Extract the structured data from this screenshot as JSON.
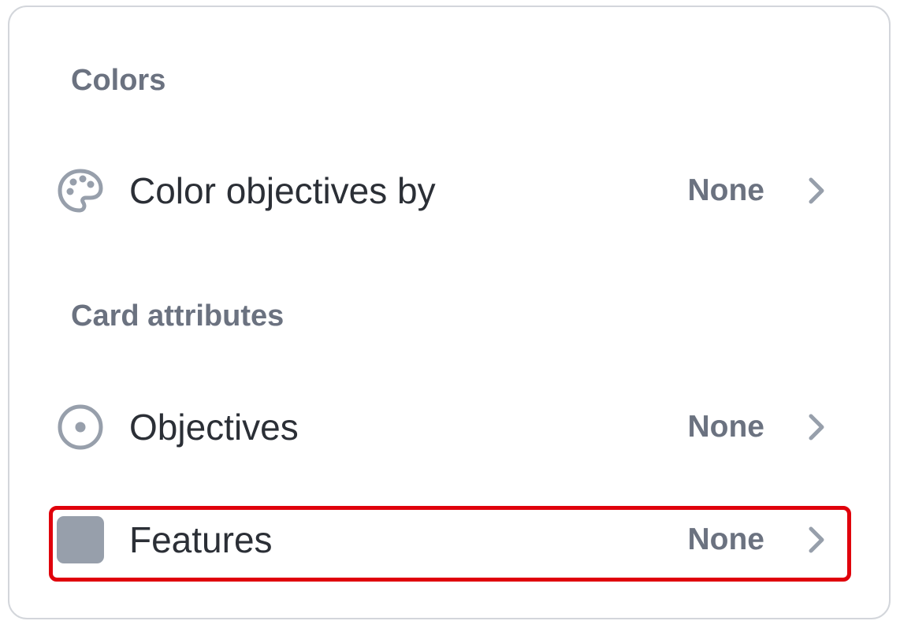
{
  "sections": {
    "colors": {
      "title": "Colors"
    },
    "card_attributes": {
      "title": "Card attributes"
    }
  },
  "rows": {
    "color_objectives_by": {
      "label": "Color objectives by",
      "value": "None",
      "icon": "palette-icon"
    },
    "objectives": {
      "label": "Objectives",
      "value": "None",
      "icon": "target-circle-icon"
    },
    "features": {
      "label": "Features",
      "value": "None",
      "icon": "square-swatch-icon",
      "highlighted": true
    }
  },
  "colors": {
    "text_primary": "#2b2f36",
    "text_secondary": "#6b7280",
    "icon_gray": "#979fab",
    "highlight_border": "#e0000b",
    "panel_border": "#d3d6db"
  }
}
